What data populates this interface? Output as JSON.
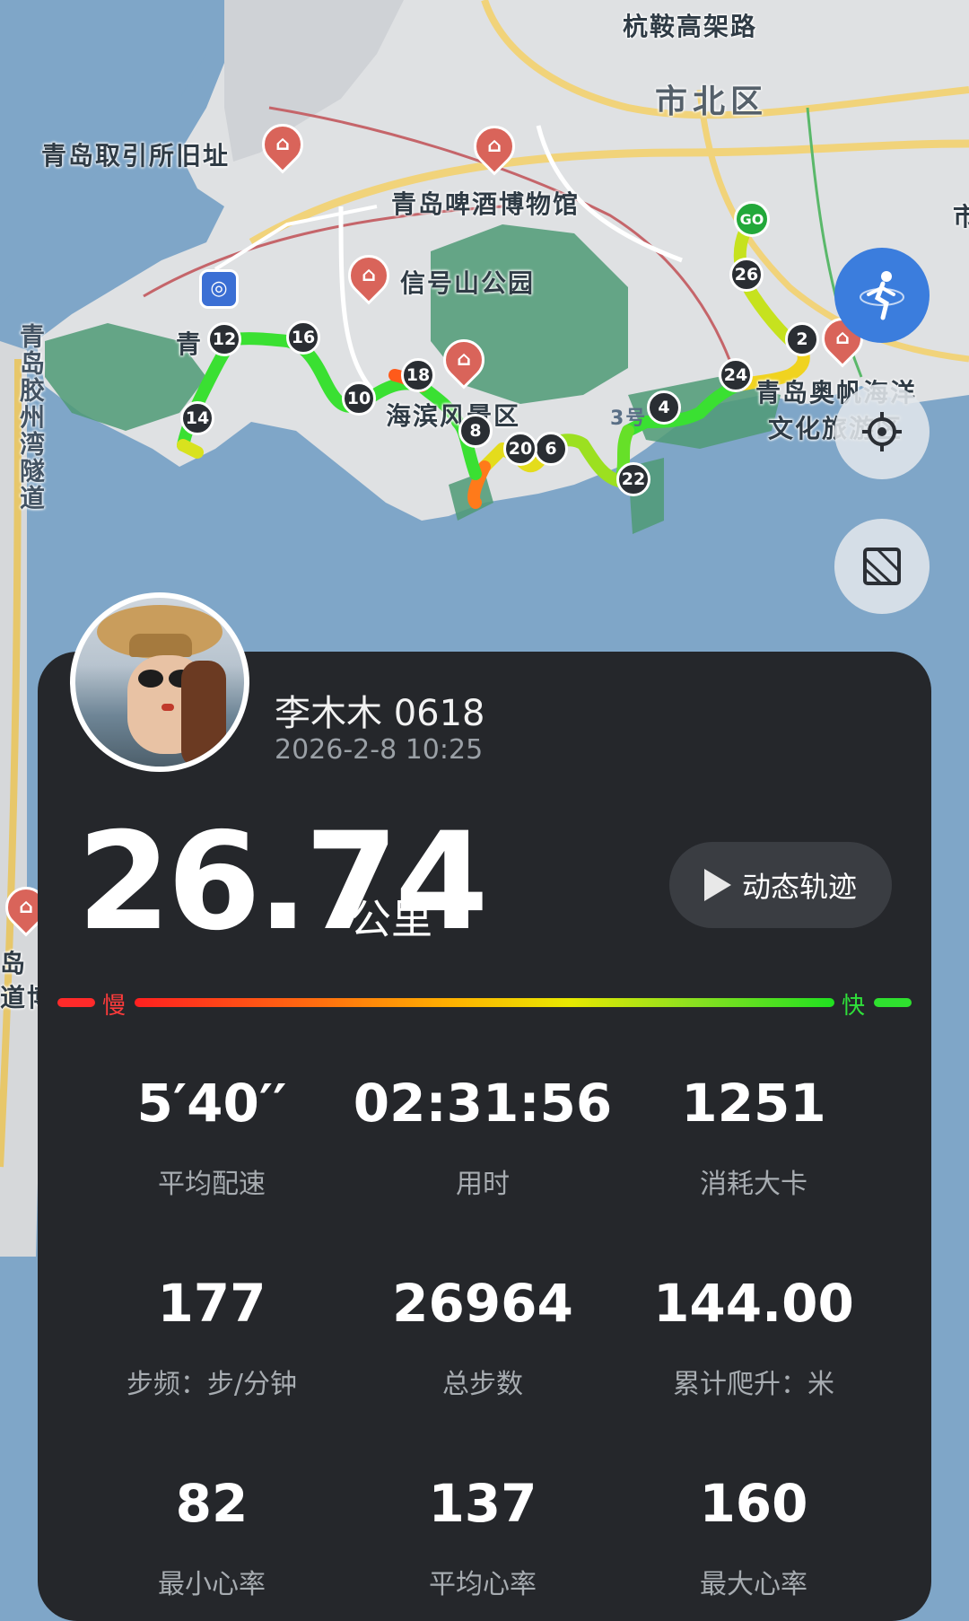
{
  "map": {
    "labels": {
      "road_hangjian": "杭鞍高架路",
      "district_shibei": "市北区",
      "exchange_site": "青岛取引所旧址",
      "beer_museum": "青岛啤酒博物馆",
      "xinhaoshan": "信号山公园",
      "bay_tunnel": "青岛胶州湾隧道",
      "station_partial": "青",
      "haibin_partial": "海滨风景区",
      "aofan_line1": "青岛奥帆海洋",
      "aofan_line2": "文化旅游区",
      "line3": "3号",
      "left_partial1": "岛",
      "left_partial2": "道博",
      "right_edge": "市"
    },
    "start_marker": "GO",
    "km_markers": [
      "26",
      "2",
      "24",
      "4",
      "22",
      "6",
      "20",
      "8",
      "18",
      "10",
      "16",
      "12",
      "14"
    ],
    "colors": {
      "water": "#7fa6c8",
      "land": "#dfe1e3",
      "park": "#4f9a76",
      "route_fast": "#3ae032",
      "route_mid": "#d8e21e",
      "route_slow": "#ff7a1a"
    }
  },
  "buttons": {
    "mode_icon": "runner-icon",
    "locate_icon": "locate-icon",
    "layer_icon": "layer-icon"
  },
  "profile": {
    "name": "李木木 0618",
    "datetime": "2026-2-8 10:25"
  },
  "summary": {
    "distance": "26.74",
    "unit": "公里",
    "replay_label": "动态轨迹"
  },
  "speed_legend": {
    "slow": "慢",
    "fast": "快"
  },
  "stats": [
    {
      "value": "5′40′′",
      "label": "平均配速"
    },
    {
      "value": "02:31:56",
      "label": "用时"
    },
    {
      "value": "1251",
      "label": "消耗大卡"
    },
    {
      "value": "177",
      "label": "步频：步/分钟"
    },
    {
      "value": "26964",
      "label": "总步数"
    },
    {
      "value": "144.00",
      "label": "累计爬升：米"
    },
    {
      "value": "82",
      "label": "最小心率"
    },
    {
      "value": "137",
      "label": "平均心率"
    },
    {
      "value": "160",
      "label": "最大心率"
    }
  ]
}
